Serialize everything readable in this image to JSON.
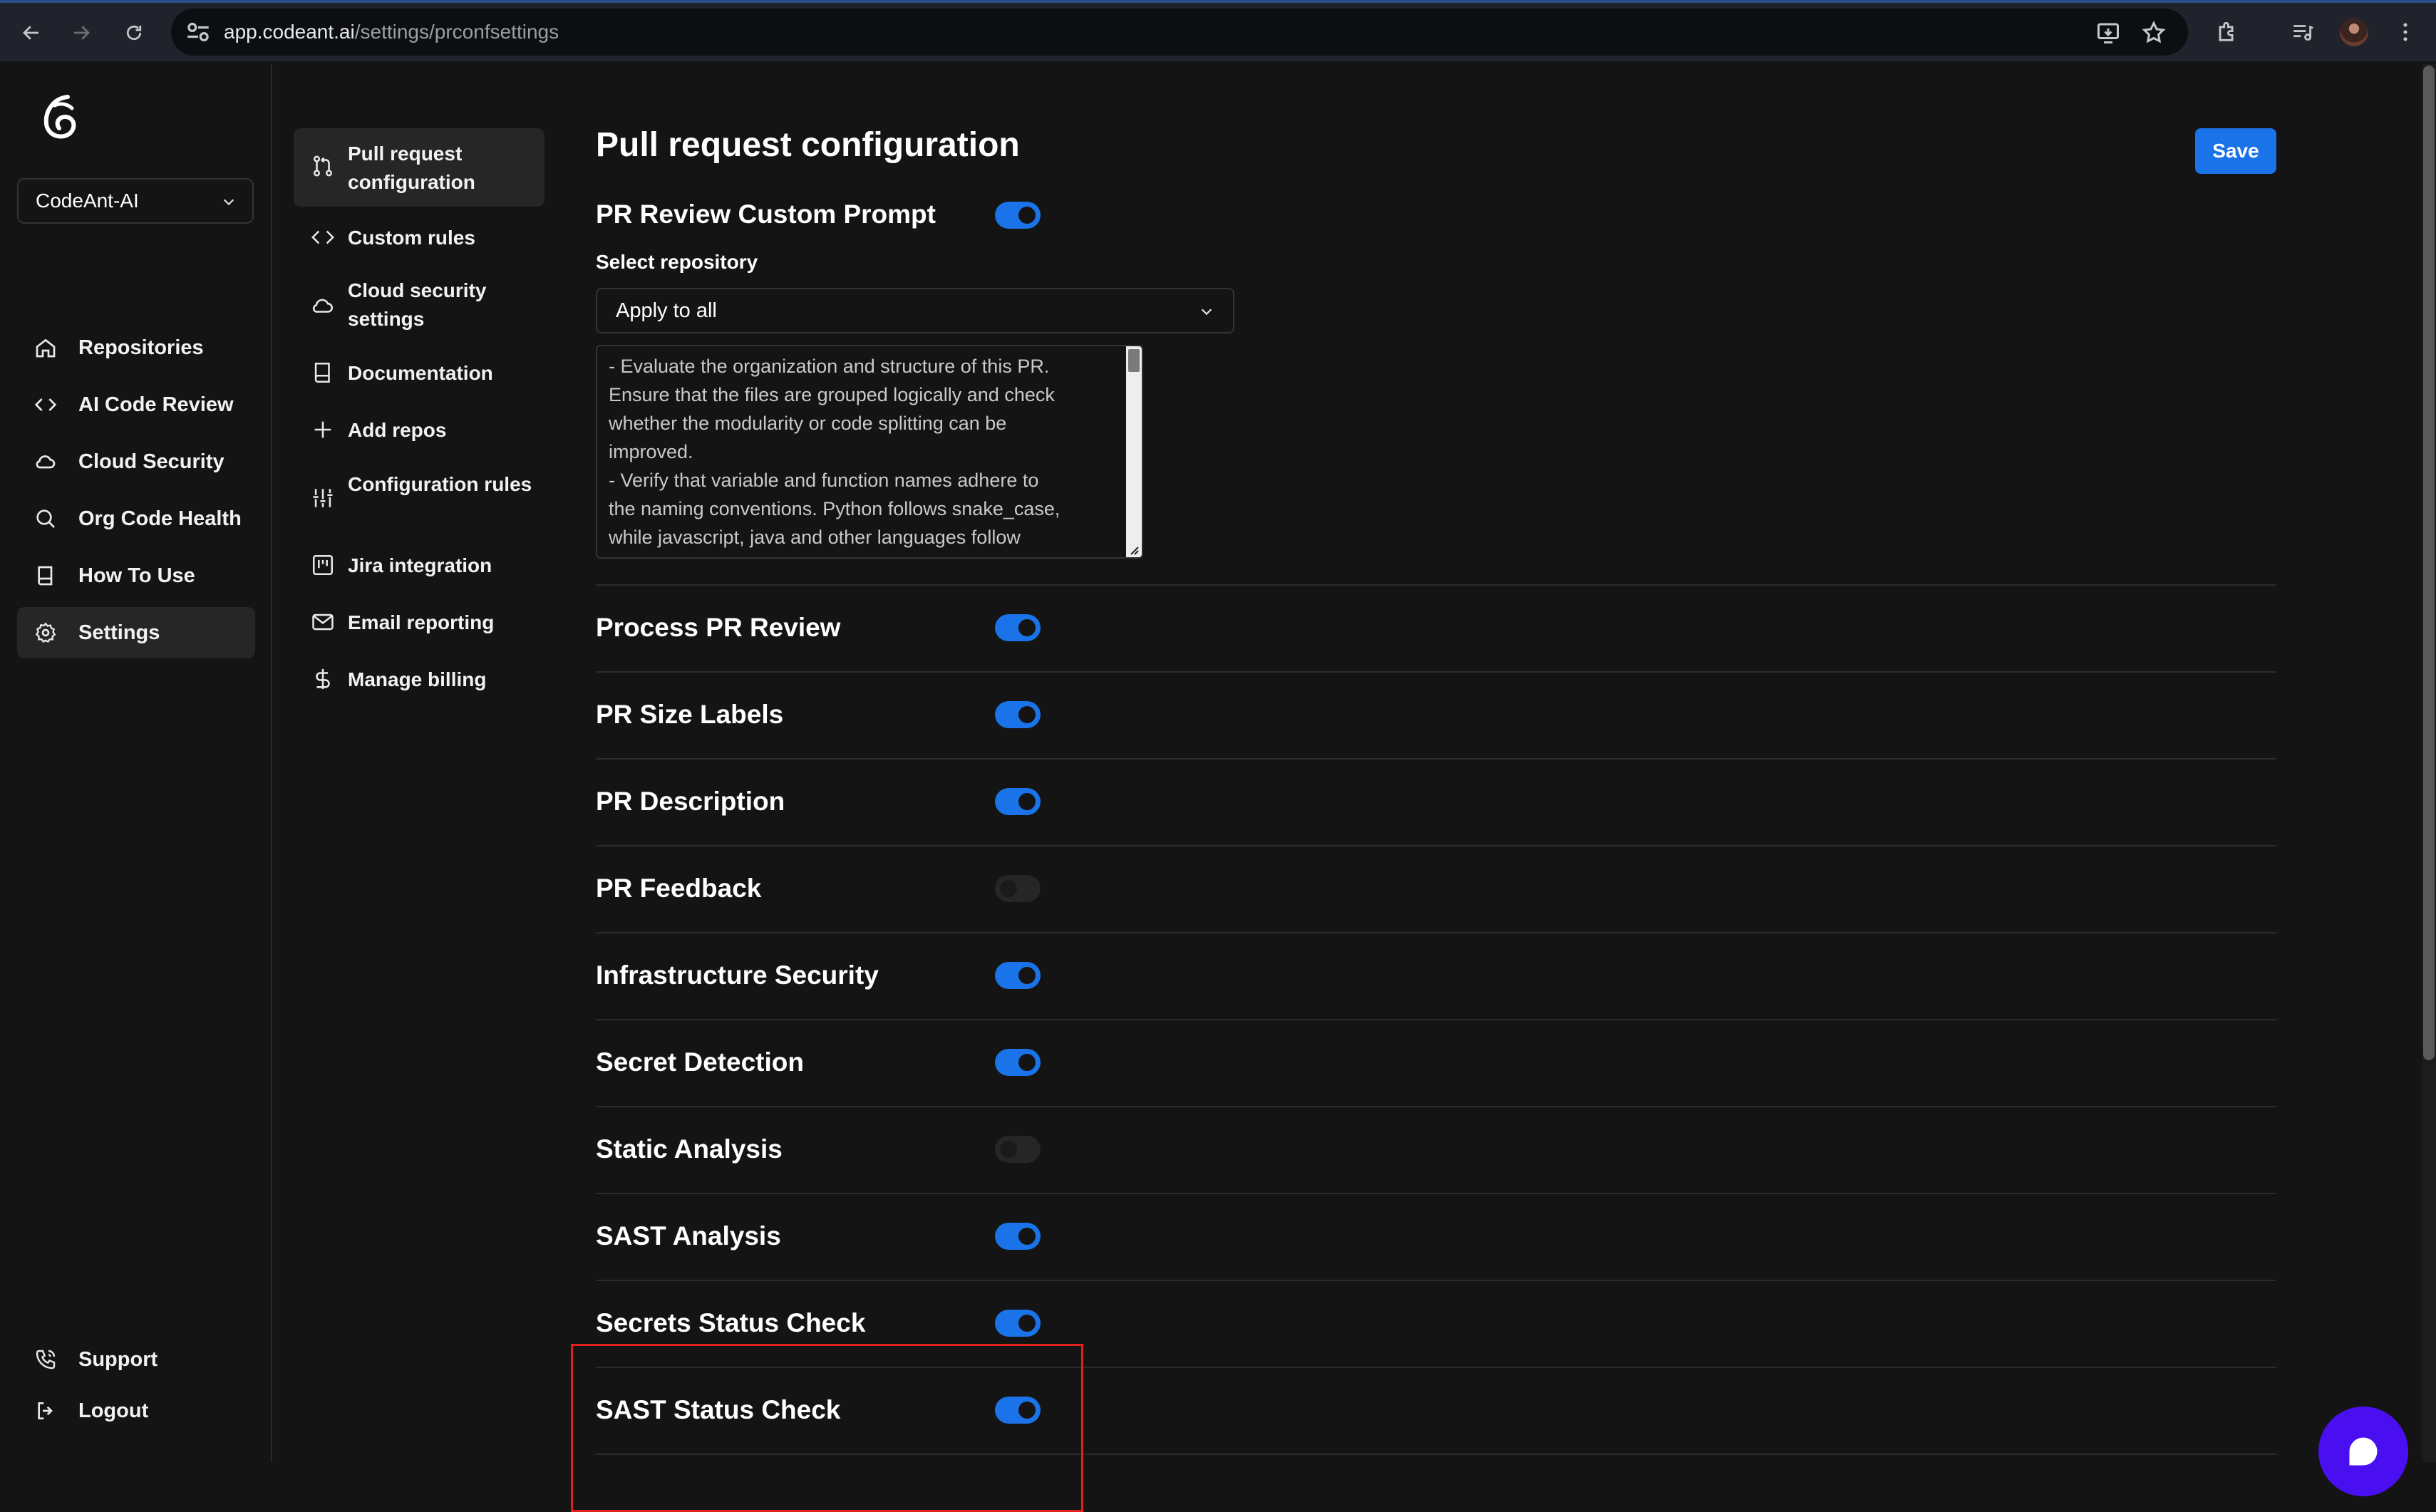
{
  "browser": {
    "url_host": "app.codeant.ai",
    "url_path": "/settings/prconfsettings"
  },
  "sidebar": {
    "org_name": "CodeAnt-AI",
    "items": [
      {
        "label": "Repositories",
        "icon": "home-icon"
      },
      {
        "label": "AI Code Review",
        "icon": "code-icon"
      },
      {
        "label": "Cloud Security",
        "icon": "cloud-icon"
      },
      {
        "label": "Org Code Health",
        "icon": "search-icon"
      },
      {
        "label": "How To Use",
        "icon": "book-icon"
      },
      {
        "label": "Settings",
        "icon": "gear-icon",
        "active": true
      }
    ],
    "footer": [
      {
        "label": "Support",
        "icon": "phone-icon"
      },
      {
        "label": "Logout",
        "icon": "logout-icon"
      }
    ]
  },
  "settings_nav": {
    "items": [
      {
        "label": "Pull request configuration",
        "icon": "git-pull-request-icon",
        "active": true
      },
      {
        "label": "Custom rules",
        "icon": "code-icon"
      },
      {
        "label": "Cloud security settings",
        "icon": "cloud-icon"
      },
      {
        "label": "Documentation",
        "icon": "book-icon"
      },
      {
        "label": "Add repos",
        "icon": "plus-icon"
      },
      {
        "label": "Configuration rules",
        "icon": "sliders-icon"
      },
      {
        "label": "Jira integration",
        "icon": "kanban-icon"
      },
      {
        "label": "Email reporting",
        "icon": "mail-icon"
      },
      {
        "label": "Manage billing",
        "icon": "dollar-icon"
      }
    ]
  },
  "main": {
    "title": "Pull request configuration",
    "save_label": "Save",
    "custom_prompt": {
      "label": "PR Review Custom Prompt",
      "enabled": true,
      "select_label": "Select repository",
      "selected_repo": "Apply to all",
      "prompt_text": "- Evaluate the organization and structure of this PR.\nEnsure that the files are grouped logically and check\nwhether the modularity or code splitting can be\nimproved.\n- Verify that variable and function names adhere to\nthe naming conventions. Python follows snake_case,\nwhile javascript, java and other languages follow"
    },
    "toggles": [
      {
        "label": "Process PR Review",
        "enabled": true
      },
      {
        "label": "PR Size Labels",
        "enabled": true
      },
      {
        "label": "PR Description",
        "enabled": true
      },
      {
        "label": "PR Feedback",
        "enabled": false
      },
      {
        "label": "Infrastructure Security",
        "enabled": true
      },
      {
        "label": "Secret Detection",
        "enabled": true
      },
      {
        "label": "Static Analysis",
        "enabled": false
      },
      {
        "label": "SAST Analysis",
        "enabled": true
      },
      {
        "label": "Secrets Status Check",
        "enabled": true
      },
      {
        "label": "SAST Status Check",
        "enabled": true
      }
    ]
  },
  "colors": {
    "accent": "#1a73e8",
    "highlight": "#e0201f",
    "chat": "#4a0ff0",
    "background": "#141414"
  }
}
